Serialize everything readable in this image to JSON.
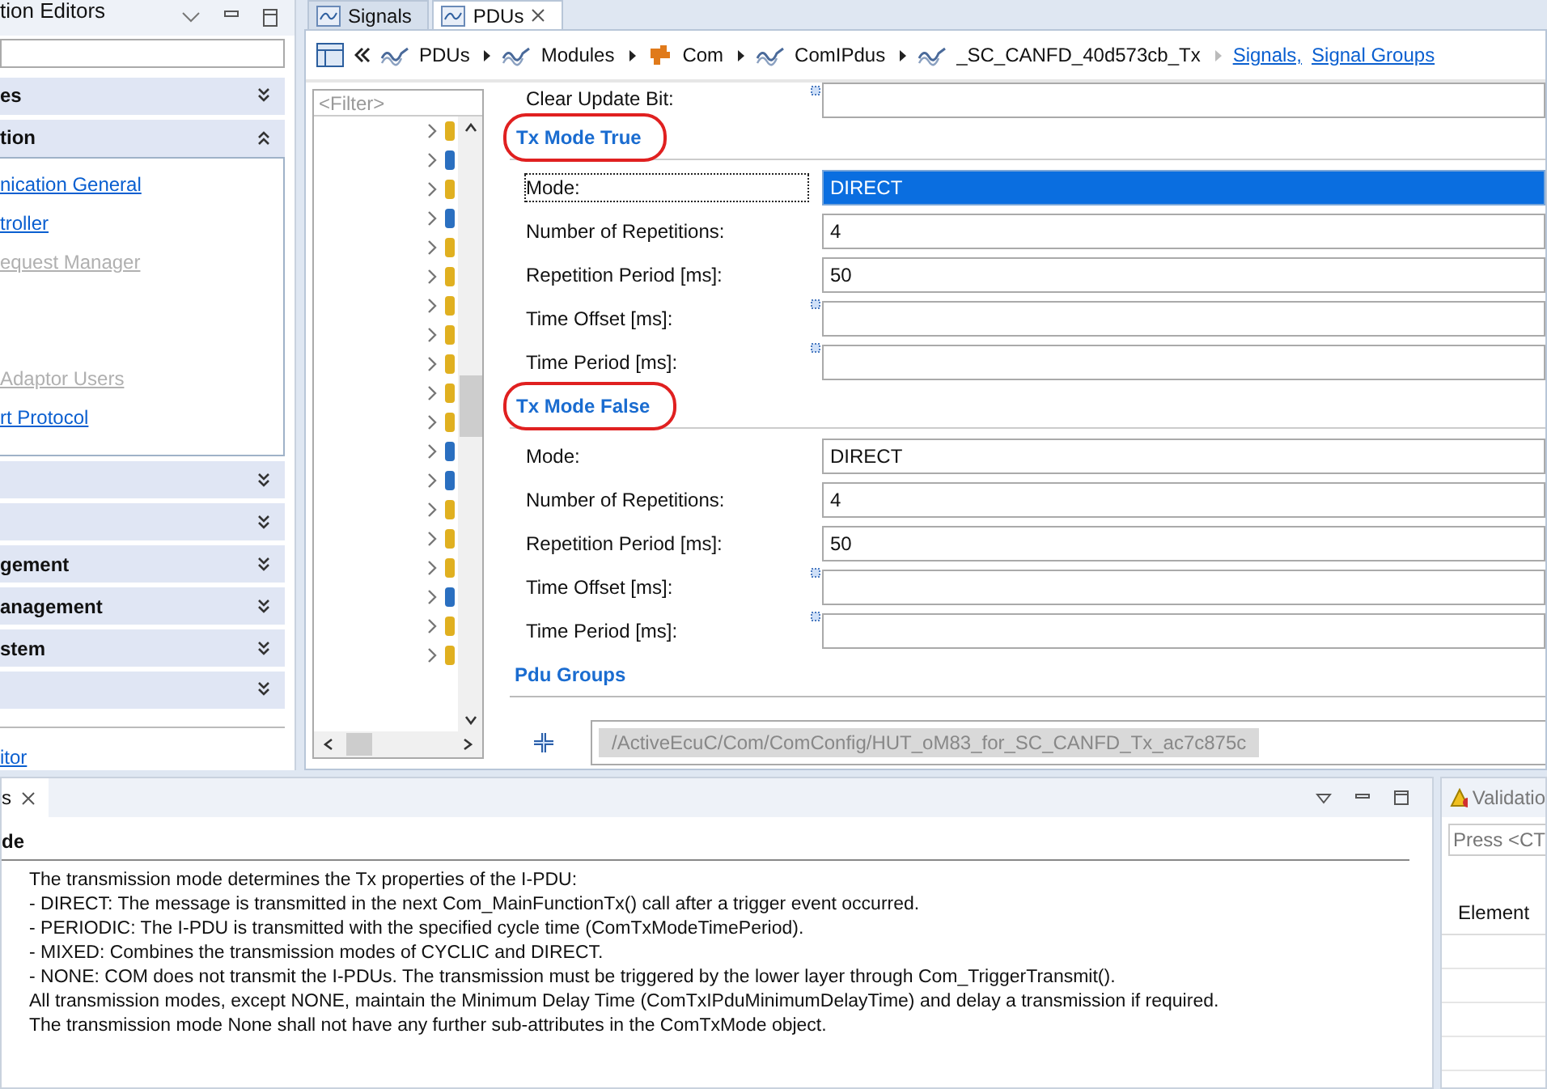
{
  "left_panel": {
    "title": "tion Editors",
    "sections": [
      {
        "label": "es",
        "expanded": false
      },
      {
        "label": "tion",
        "expanded": true,
        "items": [
          {
            "label": "nication General",
            "disabled": false,
            "gap_before": false
          },
          {
            "label": "troller",
            "disabled": false,
            "gap_before": false
          },
          {
            "label": "equest Manager",
            "disabled": true,
            "gap_before": false
          },
          {
            "label": "Adaptor Users",
            "disabled": true,
            "gap_before": true
          },
          {
            "label": "rt Protocol",
            "disabled": false,
            "gap_before": false
          }
        ]
      },
      {
        "expanded": false
      },
      {
        "expanded": false
      },
      {
        "label": "gement",
        "expanded": false
      },
      {
        "label": "anagement",
        "expanded": false
      },
      {
        "label": "stem",
        "expanded": false
      },
      {
        "expanded": false
      }
    ],
    "footer_link": "itor"
  },
  "editor": {
    "tabs": [
      {
        "label": "Signals",
        "selected": false
      },
      {
        "label": "PDUs",
        "selected": true
      }
    ],
    "breadcrumb": [
      {
        "label": "PDUs",
        "kind": "wave"
      },
      {
        "label": "Modules",
        "kind": "wave"
      },
      {
        "label": "Com",
        "kind": "module"
      },
      {
        "label": "ComIPdus",
        "kind": "wave"
      },
      {
        "label": "_SC_CANFD_40d573cb_Tx",
        "kind": "wave"
      }
    ],
    "links": [
      "Signals,",
      "Signal Groups"
    ],
    "tree": {
      "filter_placeholder": "<Filter>",
      "rows": [
        {
          "kind": "yellow"
        },
        {
          "kind": "blue"
        },
        {
          "kind": "yellow"
        },
        {
          "kind": "blue"
        },
        {
          "kind": "yellow"
        },
        {
          "kind": "yellow"
        },
        {
          "kind": "yellow"
        },
        {
          "kind": "yellow"
        },
        {
          "kind": "yellow"
        },
        {
          "kind": "yellow"
        },
        {
          "kind": "yellow"
        },
        {
          "kind": "blue"
        },
        {
          "kind": "blue"
        },
        {
          "kind": "yellow"
        },
        {
          "kind": "yellow"
        },
        {
          "kind": "yellow"
        },
        {
          "kind": "blue"
        },
        {
          "kind": "yellow"
        },
        {
          "kind": "yellow"
        }
      ]
    },
    "clear_update_bit": {
      "label": "Clear Update Bit:",
      "marker": true
    },
    "sections": [
      {
        "title": "Tx Mode True",
        "annotated": true,
        "fields": [
          {
            "label": "Mode:",
            "value": "DIRECT",
            "selected": true,
            "marker": false
          },
          {
            "label": "Number of Repetitions:",
            "value": "4",
            "selected": false,
            "marker": false
          },
          {
            "label": "Repetition Period [ms]:",
            "value": "50",
            "selected": false,
            "marker": false
          },
          {
            "label": "Time Offset [ms]:",
            "selected": false,
            "marker": true
          },
          {
            "label": "Time Period [ms]:",
            "selected": false,
            "marker": true
          }
        ]
      },
      {
        "title": "Tx Mode False",
        "annotated": true,
        "fields": [
          {
            "label": "Mode:",
            "value": "DIRECT",
            "selected": false,
            "marker": false
          },
          {
            "label": "Number of Repetitions:",
            "value": "4",
            "selected": false,
            "marker": false
          },
          {
            "label": "Repetition Period [ms]:",
            "value": "50",
            "selected": false,
            "marker": false
          },
          {
            "label": "Time Offset [ms]:",
            "selected": false,
            "marker": true
          },
          {
            "label": "Time Period [ms]:",
            "selected": false,
            "marker": true
          }
        ]
      }
    ],
    "pdu_groups": {
      "title": "Pdu Groups",
      "path": "/ActiveEcuC/Com/ComConfig/HUT_oM83_for_SC_CANFD_Tx_ac7c875c"
    }
  },
  "description_panel": {
    "tab": "s",
    "heading": "de",
    "lines": [
      "The transmission mode determines the Tx properties of the I-PDU:",
      "- DIRECT: The message is transmitted in the next Com_MainFunctionTx() call after a trigger event occurred.",
      "- PERIODIC: The I-PDU is transmitted with the specified cycle time (ComTxModeTimePeriod).",
      "- MIXED: Combines the transmission modes of CYCLIC and DIRECT.",
      "- NONE: COM does not transmit the I-PDUs. The transmission must be triggered by the lower layer through Com_TriggerTransmit().",
      "All transmission modes, except NONE, maintain the Minimum Delay Time (ComTxIPduMinimumDelayTime) and delay a transmission if required.",
      "The transmission mode None shall not have any further sub-attributes in the ComTxMode object."
    ]
  },
  "validation_panel": {
    "tab": "Validatio",
    "search_placeholder": "Press <CT",
    "column": "Element"
  }
}
